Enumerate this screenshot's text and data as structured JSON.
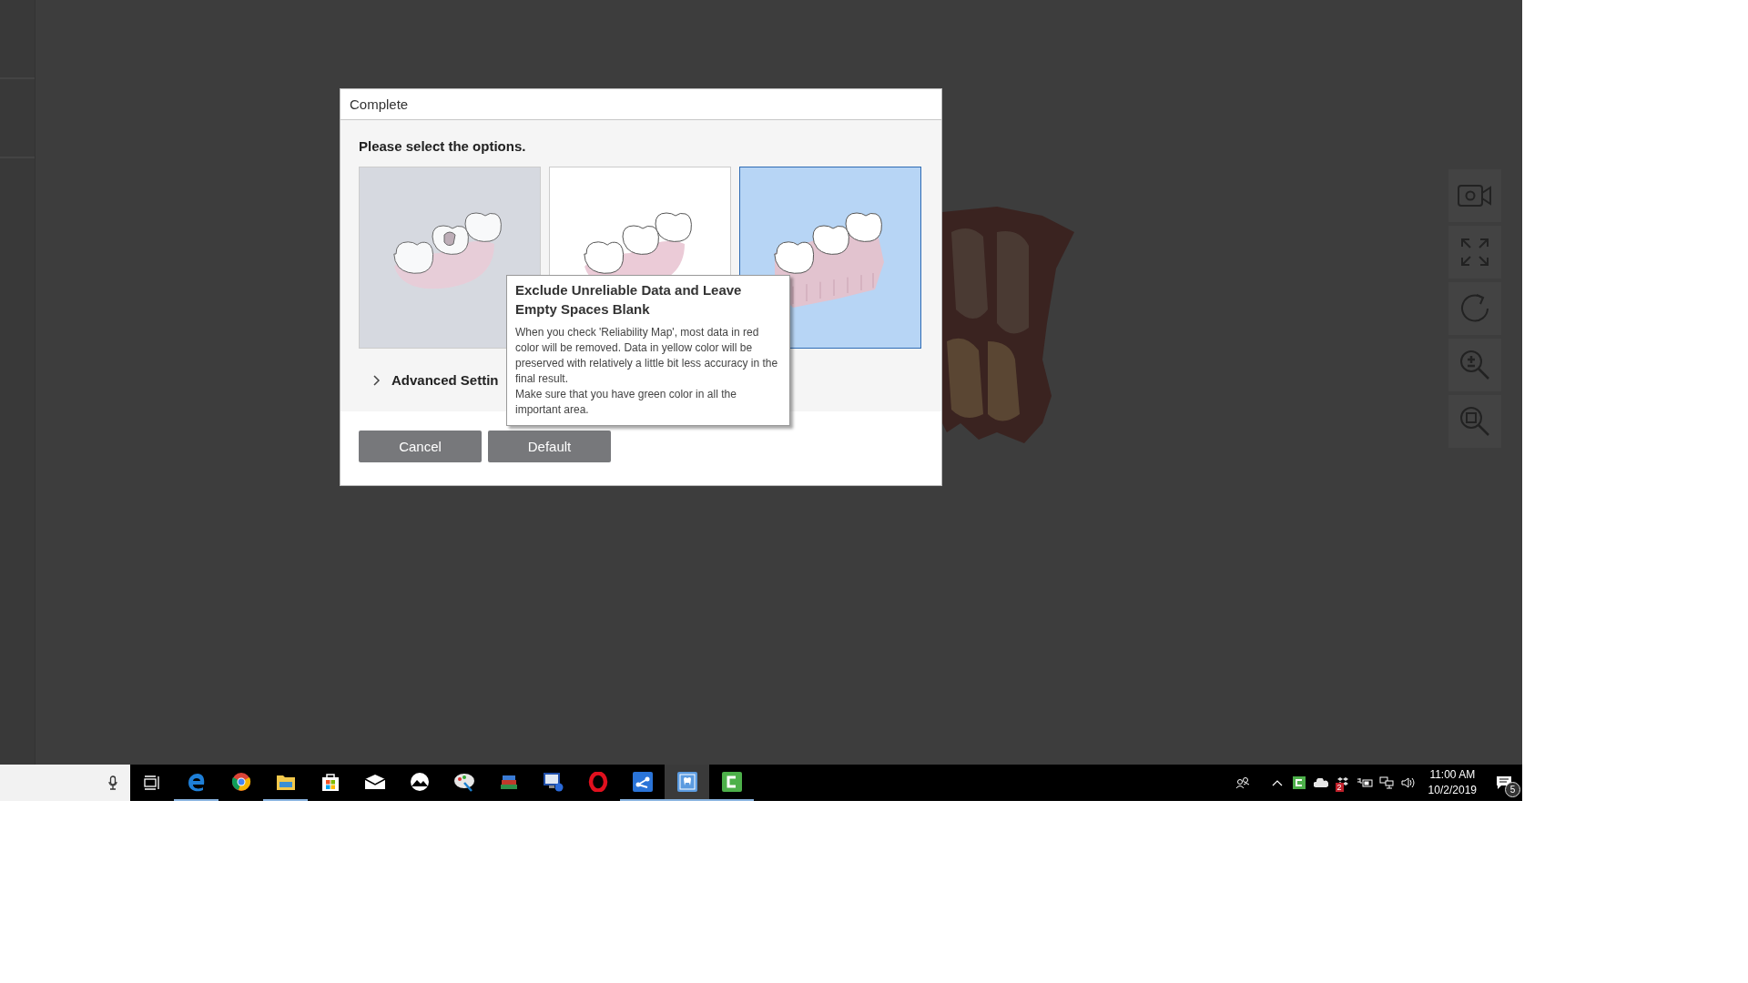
{
  "dialog": {
    "title": "Complete",
    "prompt": "Please select the options.",
    "options": [
      {
        "kind": "broken",
        "selected": false,
        "disabled": true
      },
      {
        "kind": "plain",
        "selected": false,
        "disabled": false
      },
      {
        "kind": "base",
        "selected": true,
        "disabled": false
      }
    ],
    "advanced": {
      "label": "Advanced Settin",
      "expanded": false
    },
    "tooltip": {
      "title": "Exclude Unreliable Data and Leave Empty Spaces Blank",
      "paragraphs": [
        "When you check 'Reliability Map', most data in red color will be removed. Data in yellow color will be preserved with relatively a little bit less accuracy in the final result.",
        "Make sure that you have green color in all the important area."
      ]
    },
    "buttons": [
      "Cancel",
      "Default"
    ]
  },
  "taskbar": {
    "apps": [
      {
        "kind": "edge",
        "running": true,
        "focused": false
      },
      {
        "kind": "chrome",
        "running": false,
        "focused": false
      },
      {
        "kind": "folder",
        "running": true,
        "focused": false
      },
      {
        "kind": "store",
        "running": false,
        "focused": false
      },
      {
        "kind": "mail",
        "running": false,
        "focused": false
      },
      {
        "kind": "photos",
        "running": false,
        "focused": false
      },
      {
        "kind": "paint",
        "running": false,
        "focused": false
      },
      {
        "kind": "books",
        "running": false,
        "focused": false
      },
      {
        "kind": "monitor",
        "running": false,
        "focused": false
      },
      {
        "kind": "opera",
        "running": false,
        "focused": false
      },
      {
        "kind": "share",
        "running": true,
        "focused": false
      },
      {
        "kind": "tooth",
        "running": true,
        "focused": true
      },
      {
        "kind": "camtasia",
        "running": true,
        "focused": false
      }
    ],
    "tray_badge": "2",
    "time": "11:00 AM",
    "date": "10/2/2019",
    "notifications": "5"
  }
}
